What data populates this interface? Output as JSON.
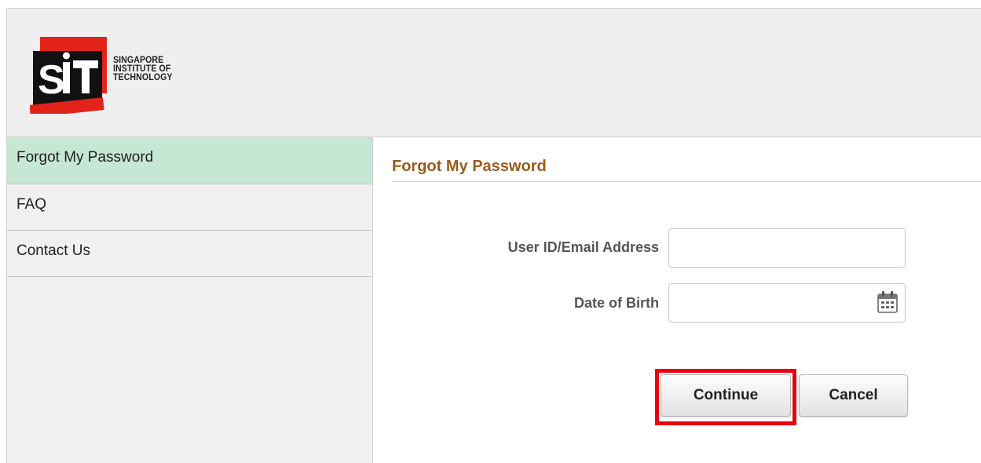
{
  "brand": {
    "logo_mark": "SiT",
    "logo_lines": [
      "SINGAPORE",
      "INSTITUTE OF",
      "TECHNOLOGY"
    ],
    "colors": {
      "red": "#e2231a",
      "black": "#111111"
    }
  },
  "sidebar": {
    "items": [
      {
        "label": "Forgot My Password",
        "active": true
      },
      {
        "label": "FAQ",
        "active": false
      },
      {
        "label": "Contact Us",
        "active": false
      }
    ],
    "active_color": "#c6e7d4"
  },
  "main": {
    "title": "Forgot My Password",
    "title_color": "#9a5a1e",
    "fields": {
      "user_id": {
        "label": "User ID/Email Address",
        "value": ""
      },
      "dob": {
        "label": "Date of Birth",
        "value": "",
        "icon": "calendar-icon"
      }
    },
    "buttons": {
      "continue": "Continue",
      "cancel": "Cancel"
    },
    "highlight_color": "#e8000b"
  }
}
